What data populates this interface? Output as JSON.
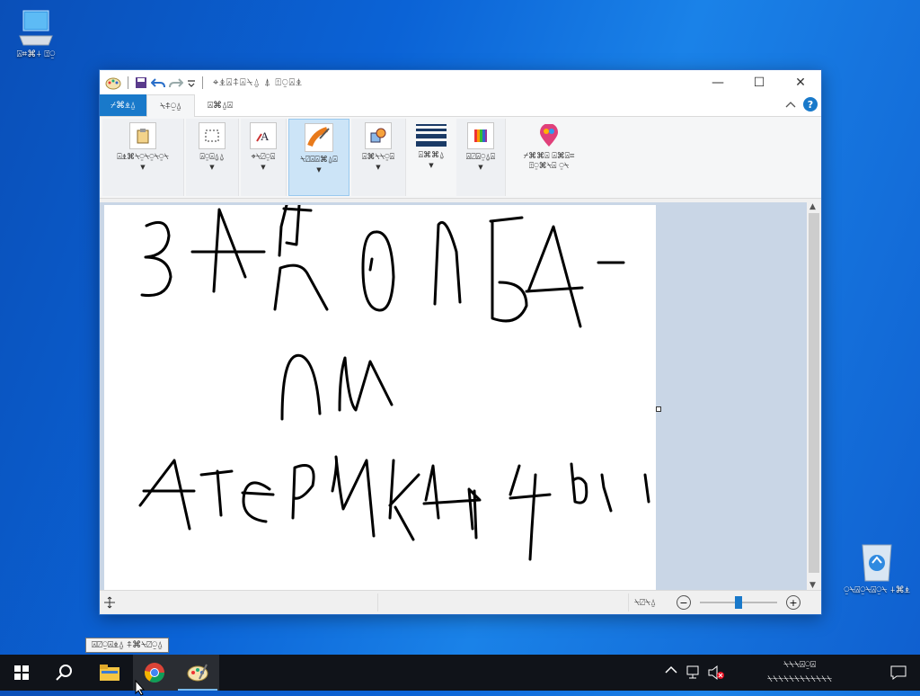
{
  "desktop": {
    "this_pc_label": "⍓⌗⌘⍭ ⍐⍜",
    "recycle_bin_label": "⍜⍀⍓⍜⍀⍓⍜⍀ ⍭⌘⍎"
  },
  "window": {
    "title": "⌖⍎⍓⍏⍓⍀⍙ ⍋ ⍐⍜⍓⍎",
    "controls": {
      "minimize": "—",
      "maximize": "☐",
      "close": "✕"
    }
  },
  "tabs": {
    "file": "⌿⌘⍎⍙",
    "home": "⍀⍏⍜⍙",
    "view": "⍓⌘⍙⍓"
  },
  "ribbon": {
    "clipboard": "⍓⍎⌘⍀⍜⍀⍜⍀⍜⍀",
    "image": "⍓⍜⍓⍙⍙",
    "tools": "⌖⍀⍁⍜⍓",
    "brushes": "⍀⍁⍓⍓⌘⍙⍓",
    "shapes": "⍓⌘⍀⍀⍜⍓",
    "size": "⍓⌘⌘⍙",
    "colours": "⍓⍁⍓⍜⍙⍓",
    "edit_paint3d_line1": "⌿⌘⌘⍓ ⍓⌘⍓⌗",
    "edit_paint3d_line2": "⍐⍜⌘⍀⍓ ⍜⍀"
  },
  "status": {
    "zoom_text": "⍀⍁⍀⍙",
    "zoom_level": 0.5
  },
  "taskbar": {
    "tooltip": "⍓⍁⍜⍓⍎⍙ ⍏⌘⍀⍁⍜⍙",
    "clock_line1": "⍀⍀⍀⍓⍜⍓",
    "clock_line2": "⍀⍀⍀⍀⍀⍀⍀⍀⍀⍀⍀⍀"
  },
  "colors": {
    "accent": "#1979ca",
    "desktop": "#0b63d6",
    "taskbar": "#101319"
  }
}
